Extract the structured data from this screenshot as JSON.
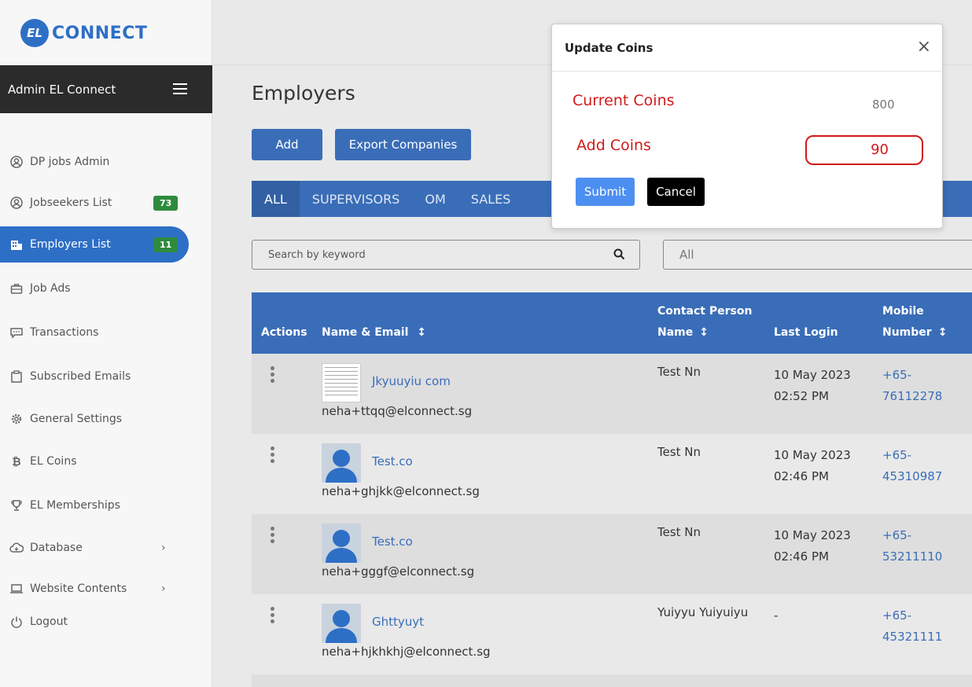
{
  "brand": {
    "logo_mark": "EL",
    "name": "CONNECT"
  },
  "admin": {
    "title": "Admin EL Connect"
  },
  "sidebar": {
    "items": [
      {
        "label": "DP jobs Admin",
        "icon": "user-circle-icon"
      },
      {
        "label": "Jobseekers List",
        "icon": "user-circle-icon",
        "badge": "73"
      },
      {
        "label": "Employers List",
        "icon": "building-icon",
        "badge": "11",
        "active": true
      },
      {
        "label": "Job Ads",
        "icon": "briefcase-icon"
      },
      {
        "label": "Transactions",
        "icon": "message-icon"
      },
      {
        "label": "Subscribed Emails",
        "icon": "clipboard-icon"
      },
      {
        "label": "General Settings",
        "icon": "gear-icon"
      },
      {
        "label": "EL Coins",
        "icon": "bitcoin-icon"
      },
      {
        "label": "EL Memberships",
        "icon": "trophy-icon"
      },
      {
        "label": "Database",
        "icon": "cloud-icon",
        "has_submenu": true
      },
      {
        "label": "Website Contents",
        "icon": "laptop-icon",
        "has_submenu": true
      },
      {
        "label": "Logout",
        "icon": "power-icon"
      }
    ]
  },
  "main": {
    "title": "Employers",
    "add_label": "Add",
    "export_label": "Export Companies",
    "tabs": [
      "ALL",
      "SUPERVISORS",
      "OM",
      "SALES"
    ],
    "search_placeholder": "Search by keyword",
    "filter_value": "All"
  },
  "table": {
    "headers": {
      "actions": "Actions",
      "name_email": "Name & Email",
      "contact_line1": "Contact Person",
      "contact_line2": "Name",
      "last_login": "Last Login",
      "mobile_line1": "Mobile",
      "mobile_line2": "Number",
      "sort_glyph": "↕"
    },
    "rows": [
      {
        "company": "Jkyuuyiu com",
        "email": "neha+ttqq@elconnect.sg",
        "contact": "Test Nn",
        "login_date": "10 May 2023",
        "login_time": "02:52 PM",
        "mobile_1": "+65-",
        "mobile_2": "76112278",
        "thumb": "document"
      },
      {
        "company": "Test.co",
        "email": "neha+ghjkk@elconnect.sg",
        "contact": "Test Nn",
        "login_date": "10 May 2023",
        "login_time": "02:46 PM",
        "mobile_1": "+65-",
        "mobile_2": "45310987",
        "thumb": "avatar"
      },
      {
        "company": "Test.co",
        "email": "neha+gggf@elconnect.sg",
        "contact": "Test Nn",
        "login_date": "10 May 2023",
        "login_time": "02:46 PM",
        "mobile_1": "+65-",
        "mobile_2": "53211110",
        "thumb": "avatar"
      },
      {
        "company": "Ghttyuyt",
        "email": "neha+hjkhkhj@elconnect.sg",
        "contact": "Yuiyyu Yuiyuiyu",
        "login_date": "-",
        "login_time": "",
        "mobile_1": "+65-",
        "mobile_2": "45321111",
        "thumb": "avatar"
      }
    ]
  },
  "modal": {
    "title": "Update Coins",
    "close_glyph": "×",
    "current_label": "Current Coins",
    "current_value": "800",
    "add_label": "Add Coins",
    "add_value": "90",
    "submit_label": "Submit",
    "cancel_label": "Cancel"
  },
  "colors": {
    "primary": "#3a6db8",
    "badge_green": "#2e8b3e",
    "annotation_red": "#d11a1a",
    "submit_blue": "#4d8ff0"
  }
}
